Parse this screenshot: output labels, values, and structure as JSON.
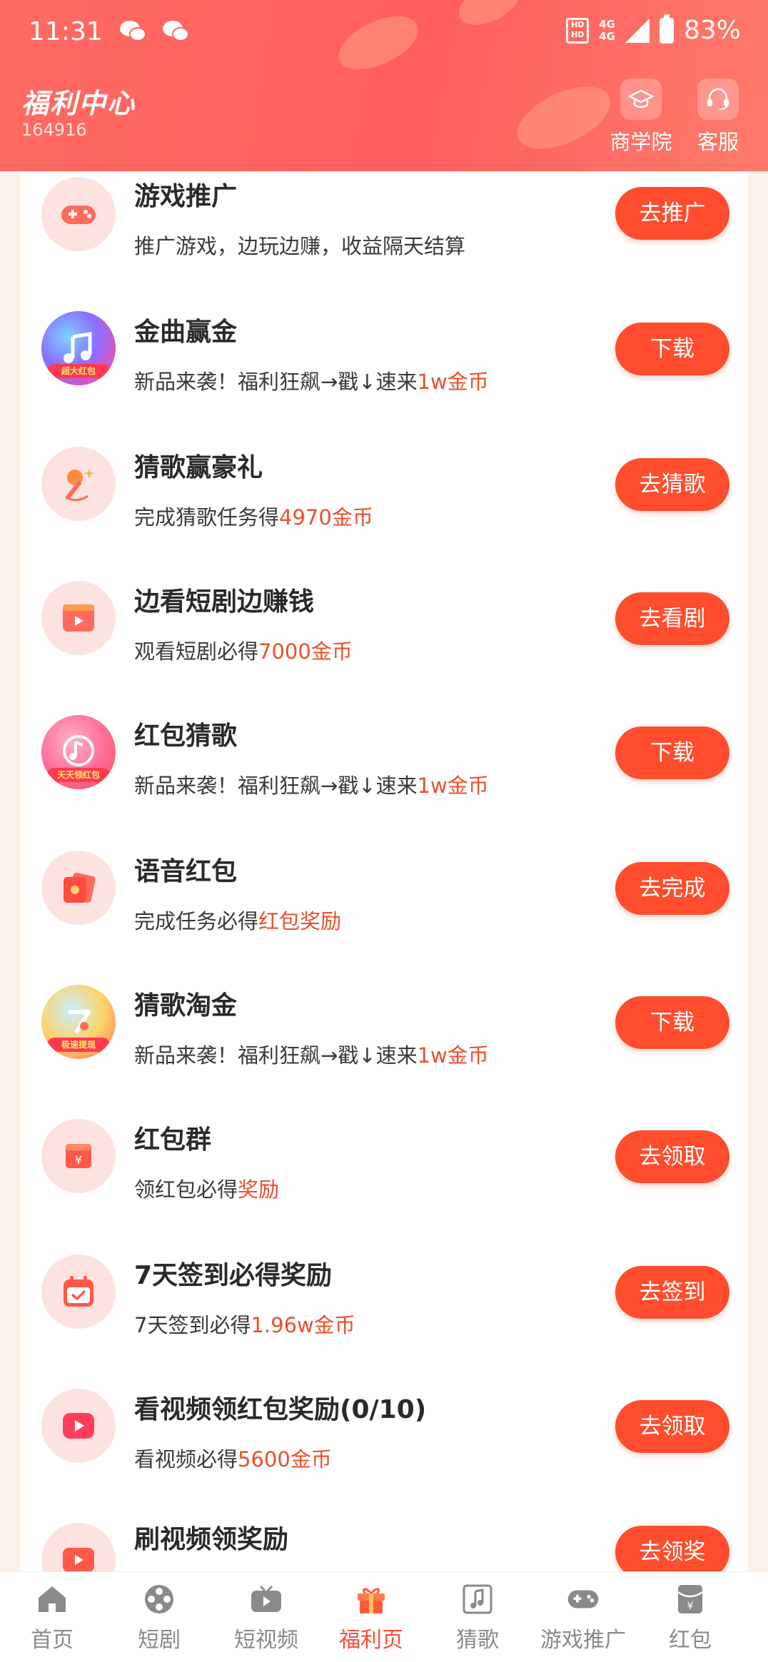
{
  "status_bar": {
    "time": "11:31",
    "network": "4G",
    "battery": "83%"
  },
  "header": {
    "title": "福利中心",
    "subtitle": "164916",
    "buttons": [
      {
        "label": "商学院",
        "icon": "graduation-cap-icon"
      },
      {
        "label": "客服",
        "icon": "headset-icon"
      }
    ]
  },
  "tasks": [
    {
      "title": "游戏推广",
      "desc": "推广游戏，边玩边赚，收益隔天结算",
      "highlight": "",
      "button": "去推广",
      "icon": "gamepad-icon"
    },
    {
      "title": "金曲赢金",
      "desc": "新品来袭！福利狂飙→戳↓速来",
      "highlight": "1w金币",
      "button": "下载",
      "icon": "app-music-icon",
      "app_tag": "超大红包"
    },
    {
      "title": "猜歌赢豪礼",
      "desc": "完成猜歌任务得",
      "highlight": "4970金币",
      "button": "去猜歌",
      "icon": "microphone-icon"
    },
    {
      "title": "边看短剧边赚钱",
      "desc": "观看短剧必得",
      "highlight": "7000金币",
      "button": "去看剧",
      "icon": "video-play-icon"
    },
    {
      "title": "红包猜歌",
      "desc": "新品来袭！福利狂飙→戳↓速来",
      "highlight": "1w金币",
      "button": "下载",
      "icon": "app-music-icon",
      "app_tag": "天天领红包"
    },
    {
      "title": "语音红包",
      "desc": "完成任务必得",
      "highlight": "红包奖励",
      "button": "去完成",
      "icon": "red-envelope-icon"
    },
    {
      "title": "猜歌淘金",
      "desc": "新品来袭！福利狂飙→戳↓速来",
      "highlight": "1w金币",
      "button": "下载",
      "icon": "app-music-icon",
      "app_tag": "极速提现"
    },
    {
      "title": "红包群",
      "desc": "领红包必得",
      "highlight": "奖励",
      "button": "去领取",
      "icon": "yuan-envelope-icon"
    },
    {
      "title": "7天签到必得奖励",
      "desc": "7天签到必得",
      "highlight": "1.96w金币",
      "button": "去签到",
      "icon": "calendar-check-icon"
    },
    {
      "title": "看视频领红包奖励(0/10)",
      "desc": "看视频必得",
      "highlight": "5600金币",
      "button": "去领取",
      "icon": "play-icon"
    },
    {
      "title": "刷视频领奖励",
      "desc": "",
      "highlight": "",
      "button": "去领奖",
      "icon": "video-icon"
    }
  ],
  "bottom_nav": [
    {
      "label": "首页",
      "icon": "home-icon"
    },
    {
      "label": "短剧",
      "icon": "film-reel-icon"
    },
    {
      "label": "短视频",
      "icon": "tv-icon"
    },
    {
      "label": "福利页",
      "icon": "gift-icon",
      "active": true
    },
    {
      "label": "猜歌",
      "icon": "music-note-icon"
    },
    {
      "label": "游戏推广",
      "icon": "gamepad-icon"
    },
    {
      "label": "红包",
      "icon": "red-envelope-icon"
    }
  ],
  "colors": {
    "accent": "#ff4d2d",
    "highlight": "#e8502e",
    "header": "#ff6361",
    "nav_active": "#ff4a3a"
  }
}
